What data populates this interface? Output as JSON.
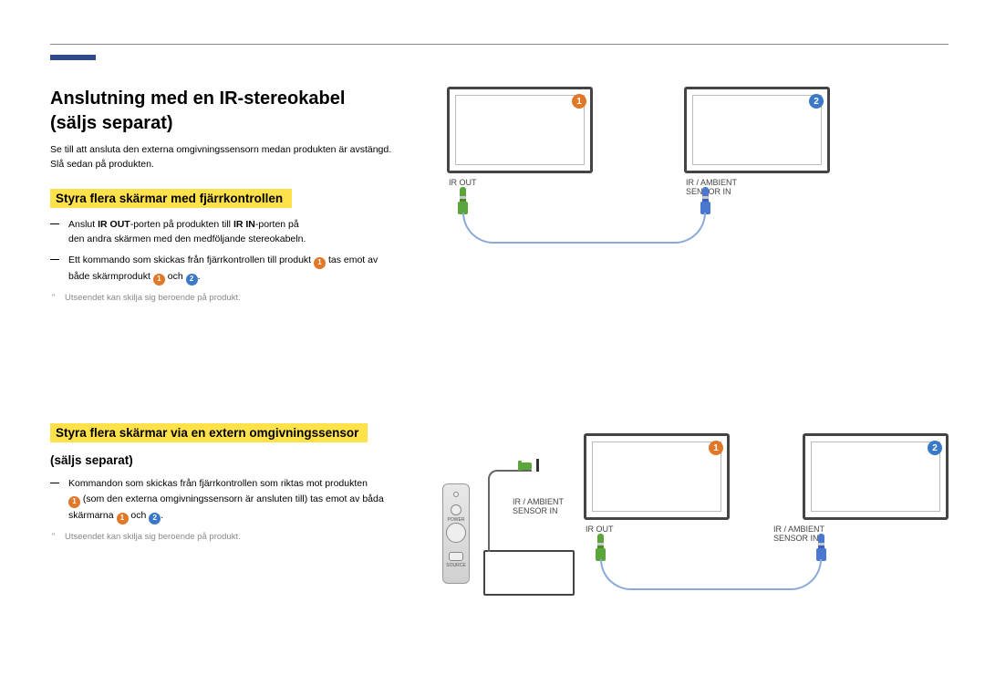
{
  "heading_line1": "Anslutning med en IR-stereokabel",
  "heading_line2": "(säljs separat)",
  "intro_line1": "Se till att ansluta den externa omgivningssensorn medan produkten är avstängd.",
  "intro_line2": "Slå sedan på produkten.",
  "section1": {
    "title": "Styra flera skärmar med fjärrkontrollen",
    "bullet1_pre": "Anslut ",
    "bullet1_bold1": "IR OUT",
    "bullet1_mid": "-porten på produkten till ",
    "bullet1_bold2": "IR IN",
    "bullet1_post": "-porten på",
    "bullet1_line2": "den andra skärmen med den medföljande stereokabeln.",
    "bullet2_pre": "Ett kommando som skickas från fjärrkontrollen till produkt ",
    "bullet2_mid": " tas emot av",
    "bullet2_line2_pre": "både skärmprodukt ",
    "bullet2_line2_mid": " och ",
    "bullet2_line2_post": ".",
    "note": "Utseendet kan skilja sig beroende på produkt."
  },
  "section2": {
    "title": "Styra flera skärmar via en extern omgivningssensor",
    "subtitle": "(säljs separat)",
    "bullet_pre": "Kommandon som skickas från fjärrkontrollen som riktas mot produkten",
    "bullet_line2_pre": " (som den externa omgivningssensorn är ansluten till) tas emot av båda",
    "bullet_line3_pre": "skärmarna ",
    "bullet_line3_mid": " och ",
    "bullet_line3_post": ".",
    "note": "Utseendet kan skilja sig beroende på produkt."
  },
  "labels": {
    "ir_out": "IR OUT",
    "ir_ambient1": "IR / AMBIENT",
    "ir_ambient2": "SENSOR IN",
    "num1": "1",
    "num2": "2",
    "power": "POWER",
    "source": "SOURCE",
    "bullet_marker": "―"
  }
}
